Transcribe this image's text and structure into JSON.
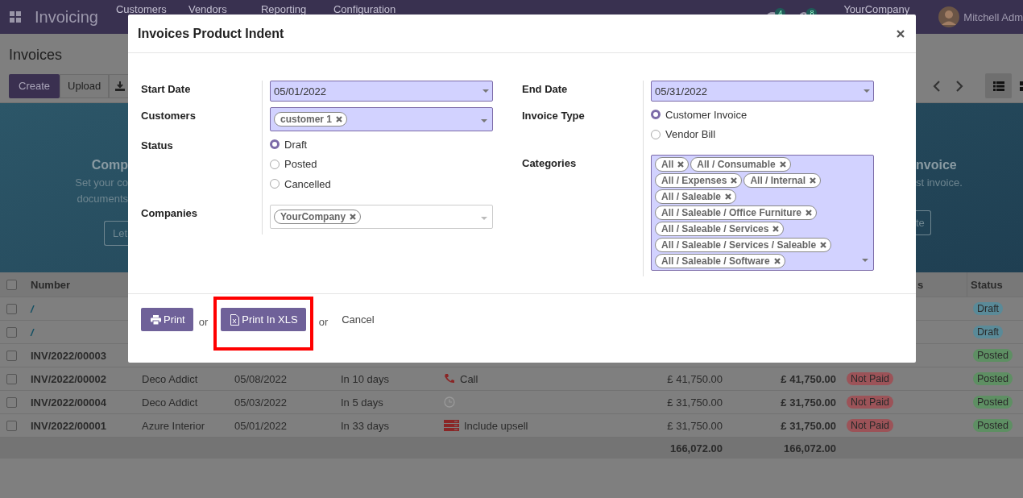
{
  "topbar": {
    "app": "Invoicing",
    "menu": [
      "Customers",
      "Vendors",
      "Reporting",
      "Configuration"
    ],
    "messages": "4",
    "activities": "8",
    "company": "YourCompany",
    "user": "Mitchell Adm"
  },
  "control_panel": {
    "title": "Invoices",
    "create": "Create",
    "upload": "Upload",
    "views": [
      {
        "kind": "list",
        "selected": true
      },
      {
        "kind": "kanban",
        "selected": false
      }
    ]
  },
  "banner": {
    "left": {
      "title": "Comp",
      "lines": [
        "Set your co",
        "documents"
      ],
      "button": "Let"
    },
    "right": {
      "title": "nvoice",
      "lines": [
        "st invoice."
      ],
      "button": "te"
    }
  },
  "table": {
    "all_checked": false,
    "headers": {
      "number": "Number",
      "payment": "s",
      "status": "Status"
    },
    "rows": [
      {
        "checked": false,
        "number": "/",
        "draft": true,
        "status": {
          "label": "Draft",
          "color": "#5a8a98"
        }
      },
      {
        "checked": false,
        "number": "/",
        "draft": true,
        "status": {
          "label": "Draft",
          "color": "#5a8a98"
        }
      },
      {
        "checked": false,
        "number": "INV/2022/00003",
        "draft": false,
        "status": {
          "label": "Posted",
          "color": "#5e8f63"
        }
      },
      {
        "checked": false,
        "number": "INV/2022/00002",
        "draft": false,
        "customer": "Deco Addict",
        "date": "05/08/2022",
        "due": "In 10 days",
        "activity": {
          "kind": "call",
          "label": "Call"
        },
        "untaxed": "£ 41,750.00",
        "total": "£ 41,750.00",
        "payment": "Not Paid",
        "status": {
          "label": "Posted",
          "color": "#5e8f63"
        }
      },
      {
        "checked": false,
        "number": "INV/2022/00004",
        "draft": false,
        "customer": "Deco Addict",
        "date": "05/03/2022",
        "due": "In 5 days",
        "activity": {
          "kind": "clock"
        },
        "untaxed": "£ 31,750.00",
        "total": "£ 31,750.00",
        "payment": "Not Paid",
        "status": {
          "label": "Posted",
          "color": "#5e8f63"
        }
      },
      {
        "checked": false,
        "number": "INV/2022/00001",
        "draft": false,
        "customer": "Azure Interior",
        "date": "05/01/2022",
        "due": "In 33 days",
        "activity": {
          "kind": "upsell",
          "label": "Include upsell"
        },
        "untaxed": "£ 31,750.00",
        "total": "£ 31,750.00",
        "payment": "Not Paid",
        "status": {
          "label": "Posted",
          "color": "#5e8f63"
        }
      }
    ],
    "totals": {
      "untaxed": "166,072.00",
      "total": "166,072.00"
    }
  },
  "dialog": {
    "title": "Invoices Product Indent",
    "left_fields": [
      {
        "kind": "select",
        "label": "Start Date",
        "value": "05/01/2022",
        "required": true
      },
      {
        "kind": "tags",
        "label": "Customers",
        "tags": [
          "customer 1"
        ],
        "required": true
      },
      {
        "kind": "radio",
        "label": "Status",
        "options": [
          {
            "label": "Draft",
            "selected": true
          },
          {
            "label": "Posted",
            "selected": false
          },
          {
            "label": "Cancelled",
            "selected": false
          }
        ]
      },
      {
        "kind": "tags",
        "label": "Companies",
        "tags": [
          "YourCompany"
        ],
        "required": false
      }
    ],
    "right_fields": [
      {
        "kind": "select",
        "label": "End Date",
        "value": "05/31/2022",
        "required": true
      },
      {
        "kind": "radio",
        "label": "Invoice Type",
        "options": [
          {
            "label": "Customer Invoice",
            "selected": true
          },
          {
            "label": "Vendor Bill",
            "selected": false
          }
        ]
      },
      {
        "kind": "tags",
        "label": "Categories",
        "tags": [
          "All",
          "All / Consumable",
          "All / Expenses",
          "All / Internal",
          "All / Saleable",
          "All / Saleable / Office Furniture",
          "All / Saleable / Services",
          "All / Saleable / Services / Saleable",
          "All / Saleable / Software"
        ],
        "required": true
      }
    ],
    "footer": [
      {
        "kind": "print",
        "label": "Print",
        "highlighted": false
      },
      {
        "kind": "text",
        "label": "or"
      },
      {
        "kind": "export",
        "label": "Print In XLS",
        "highlighted": true
      },
      {
        "kind": "text",
        "label": "or"
      },
      {
        "kind": "link",
        "label": "Cancel"
      }
    ]
  }
}
